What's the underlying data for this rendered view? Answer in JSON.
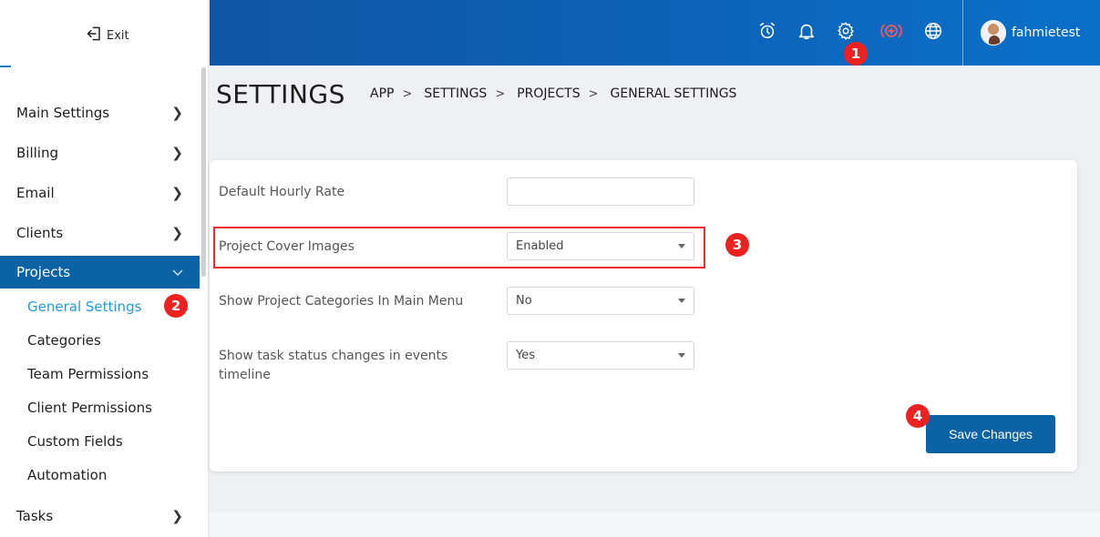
{
  "sidebar": {
    "exit_label": "Exit",
    "items": [
      {
        "label": "Main Settings",
        "chevron": ">"
      },
      {
        "label": "Billing",
        "chevron": ">"
      },
      {
        "label": "Email",
        "chevron": ">"
      },
      {
        "label": "Clients",
        "chevron": ">"
      },
      {
        "label": "Projects",
        "chevron": "v"
      },
      {
        "label": "Tasks",
        "chevron": ">"
      }
    ],
    "subitems": [
      {
        "label": "General Settings"
      },
      {
        "label": "Categories"
      },
      {
        "label": "Team Permissions"
      },
      {
        "label": "Client Permissions"
      },
      {
        "label": "Custom Fields"
      },
      {
        "label": "Automation"
      }
    ]
  },
  "topbar": {
    "username": "fahmietest",
    "icons": [
      "alarm-clock-icon",
      "bell-icon",
      "gear-icon",
      "add-circle-icon",
      "globe-icon"
    ]
  },
  "header": {
    "title": "SETTINGS",
    "breadcrumbs": [
      "APP",
      "SETTINGS",
      "PROJECTS",
      "GENERAL SETTINGS"
    ],
    "separator": ">"
  },
  "form": {
    "rows": [
      {
        "label": "Default Hourly Rate",
        "value": ""
      },
      {
        "label": "Project Cover Images",
        "value": "Enabled"
      },
      {
        "label": "Show Project Categories In Main Menu",
        "value": "No"
      },
      {
        "label": "Show task status changes in events timeline",
        "value": "Yes"
      }
    ],
    "save_label": "Save Changes"
  },
  "markers": [
    "1",
    "2",
    "3",
    "4"
  ],
  "colors": {
    "topbar_start": "#1055a3",
    "topbar_end": "#0a6fc9",
    "active_nav": "#0b62a4",
    "current_subitem": "#1f9cde",
    "highlight": "#ec2b2b",
    "badge": "#ee2020",
    "add_icon": "#ff5a5a"
  }
}
